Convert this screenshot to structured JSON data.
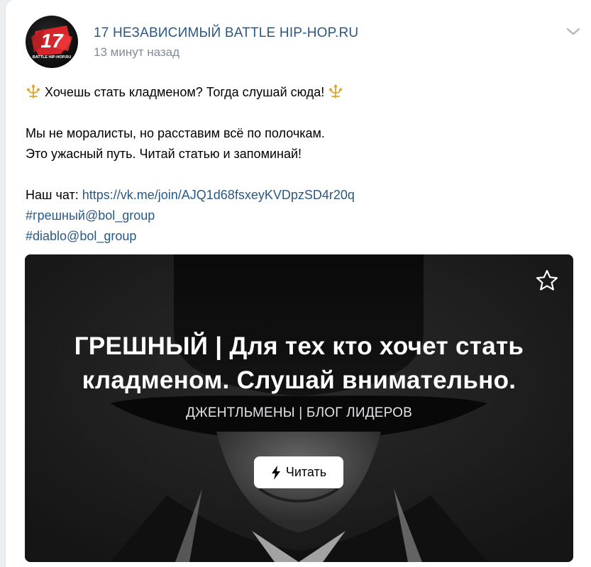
{
  "post": {
    "group_name": "17 НЕЗАВИСИМЫЙ BATTLE HIP-HOP.RU",
    "time": "13 минут назад",
    "avatar_text": "BATTLE HIP-HOP.RU",
    "avatar_number": "17",
    "text": {
      "line1": "Хочешь стать кладменом? Тогда слушай сюда!",
      "line2": "Мы не моралисты, но расставим всё по полочкам.",
      "line3": "Это ужасный путь. Читай статью и запоминай!",
      "chat_label": "Наш чат:",
      "chat_link": "https://vk.me/join/AJQ1d68fsxeyKVDpzSD4r20q",
      "hashtag1": "#грешный@bol_group",
      "hashtag2": "#diablo@bol_group"
    },
    "emoji_icon": "trident-emoji"
  },
  "article": {
    "title_line1": "ГРЕШНЫЙ | Для тех кто хочет стать",
    "title_line2": "кладменом. Слушай внимательно.",
    "author": "ДЖЕНТЛЬМЕНЫ | БЛОГ ЛИДЕРОВ",
    "read_label": "Читать",
    "read_icon": "lightning-icon",
    "bookmark_icon": "star-icon"
  },
  "colors": {
    "link": "#2a5885",
    "time": "#818c99",
    "accent": "#e02a2a"
  }
}
